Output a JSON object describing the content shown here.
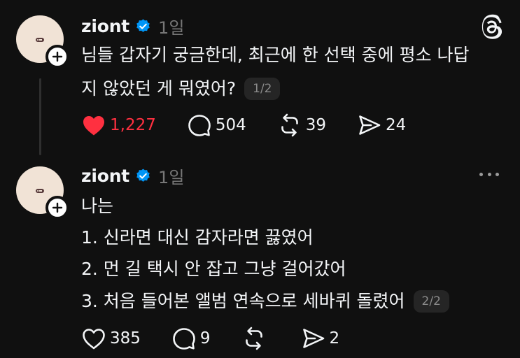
{
  "colors": {
    "background": "#101010",
    "text": "#f3f5f7",
    "muted": "#777777",
    "like_red": "#ff3040",
    "verified_blue": "#0095f6"
  },
  "posts": [
    {
      "username": "ziont",
      "time": "1일",
      "lines": [
        "님들 갑자기 궁금한데, 최근에 한 선택 중에 평소 나답",
        "지 않았던 게 뭐였어?"
      ],
      "page": "1/2",
      "liked": true,
      "likes": "1,227",
      "replies": "504",
      "reposts": "39",
      "shares": "24"
    },
    {
      "username": "ziont",
      "time": "1일",
      "lines": [
        "나는",
        "1. 신라면 대신 감자라면 끓였어",
        "2. 먼 길 택시 안 잡고 그냥 걸어갔어",
        "3. 처음 들어본 앨범 연속으로 세바퀴 돌렸어"
      ],
      "page": "2/2",
      "liked": false,
      "likes": "385",
      "replies": "9",
      "reposts": "",
      "shares": "2"
    }
  ]
}
